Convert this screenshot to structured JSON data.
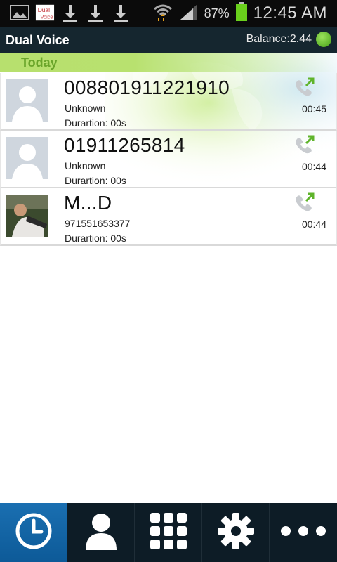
{
  "status_bar": {
    "battery_percent": "87%",
    "time": "12:45 AM",
    "icons": [
      "gallery-icon",
      "dual-voice-notification-icon",
      "download-icon",
      "download-icon",
      "download-icon",
      "wifi-icon",
      "signal-icon",
      "battery-icon"
    ]
  },
  "header": {
    "title": "Dual Voice",
    "balance": "Balance:2.44",
    "status_color": "#5fb42b"
  },
  "section": {
    "label": "Today"
  },
  "calls": [
    {
      "number": "008801911221910",
      "subtitle": "Unknown",
      "duration": "Durartion: 00s",
      "time": "00:45",
      "avatar": "default-contact"
    },
    {
      "number": "01911265814",
      "subtitle": "Unknown",
      "duration": "Durartion: 00s",
      "time": "00:44",
      "avatar": "default-contact"
    },
    {
      "number": "M...D",
      "subtitle": "971551653377",
      "duration": "Durartion: 00s",
      "time": "00:44",
      "avatar": "contact-photo"
    }
  ],
  "bottom_nav": {
    "items": [
      "recents-clock-icon",
      "contacts-person-icon",
      "dialpad-icon",
      "settings-gear-icon",
      "more-icon"
    ],
    "active_index": 0,
    "active_color": "#1a6fb1"
  }
}
